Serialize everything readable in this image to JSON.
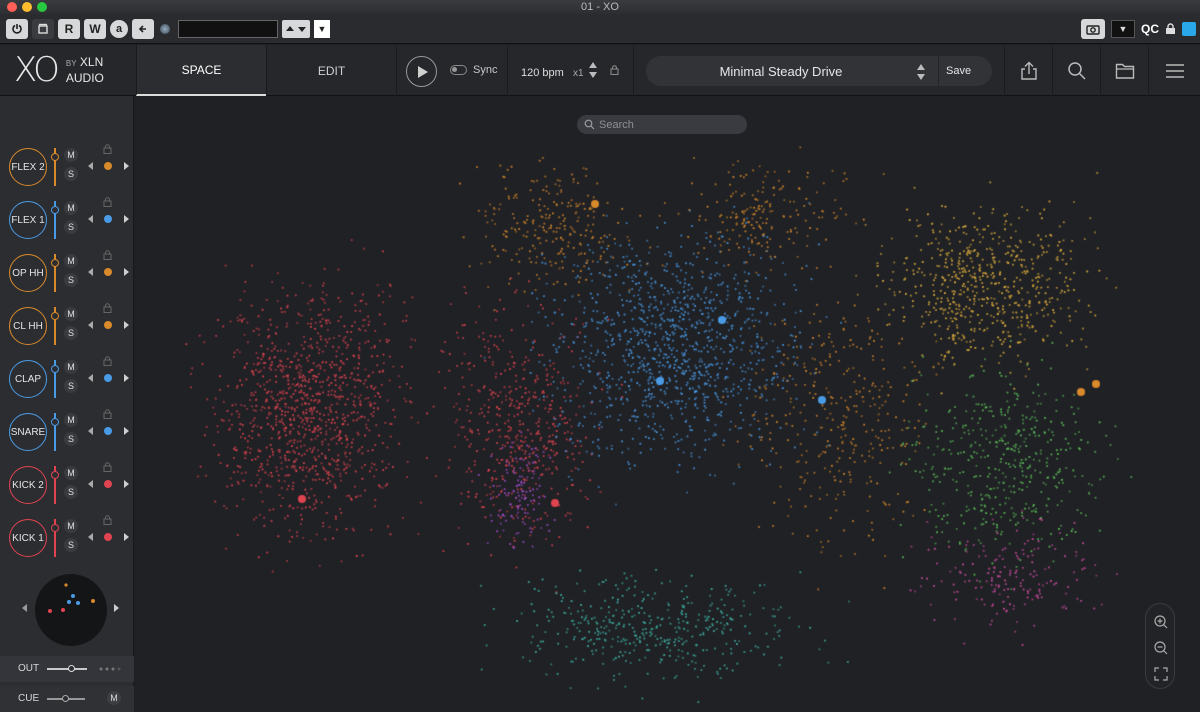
{
  "window": {
    "title": "01 - XO"
  },
  "host": {
    "buttons": [
      "R",
      "W",
      "a"
    ],
    "qc_label": "QC"
  },
  "header": {
    "logo_mark": "XO",
    "brand_by": "BY",
    "brand_xln": "XLN",
    "brand_audio": "AUDIO",
    "tabs": [
      {
        "label": "SPACE",
        "active": true
      },
      {
        "label": "EDIT",
        "active": false
      }
    ],
    "sync_label": "Sync",
    "bpm": "120 bpm",
    "multiplier": "x1",
    "preset_name": "Minimal Steady Drive",
    "save_label": "Save"
  },
  "lanes": [
    {
      "name": "FLEX 2",
      "color": "#d98a2b",
      "mute": "M",
      "solo": "S"
    },
    {
      "name": "FLEX 1",
      "color": "#4a9be6",
      "mute": "M",
      "solo": "S"
    },
    {
      "name": "OP HH",
      "color": "#d98a2b",
      "mute": "M",
      "solo": "S"
    },
    {
      "name": "CL HH",
      "color": "#d98a2b",
      "mute": "M",
      "solo": "S"
    },
    {
      "name": "CLAP",
      "color": "#4a9be6",
      "mute": "M",
      "solo": "S"
    },
    {
      "name": "SNARE",
      "color": "#4a9be6",
      "mute": "M",
      "solo": "S"
    },
    {
      "name": "KICK 2",
      "color": "#e04450",
      "mute": "M",
      "solo": "S"
    },
    {
      "name": "KICK 1",
      "color": "#e04450",
      "mute": "M",
      "solo": "S"
    }
  ],
  "output": {
    "out_label": "OUT",
    "cue_label": "CUE",
    "cue_m": "M"
  },
  "space": {
    "search_placeholder": "Search",
    "cluster_colors": {
      "kick": "#e04450",
      "snare_clap": "#4a9be6",
      "hat": "#d98a2b",
      "perc_yellow": "#e3b23c",
      "perc_green": "#5fc45a",
      "perc_teal": "#3fb7a8",
      "perc_purple": "#a64fd6",
      "perc_pink": "#d44fa6"
    }
  }
}
